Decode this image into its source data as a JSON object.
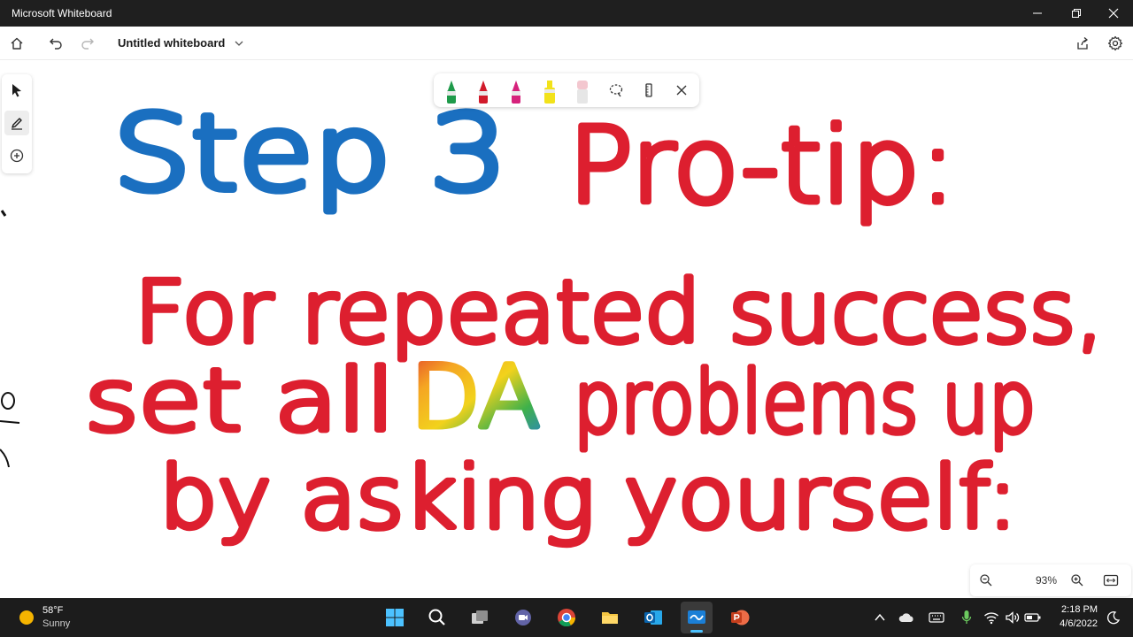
{
  "window": {
    "title": "Microsoft Whiteboard"
  },
  "toolbar": {
    "doc_title": "Untitled whiteboard"
  },
  "canvas": {
    "ink_lines": [
      {
        "text": "Step 3",
        "color": "#1a6fc0"
      },
      {
        "text": "Pro-tip:",
        "color": "#dd1f2f"
      },
      {
        "text": "For repeated success,",
        "color": "#dd1f2f"
      },
      {
        "text": "set all",
        "color": "#dd1f2f"
      },
      {
        "text": "DA",
        "color": "rainbow"
      },
      {
        "text": "problems up",
        "color": "#dd1f2f"
      },
      {
        "text": "by asking yourself:",
        "color": "#dd1f2f"
      }
    ]
  },
  "pen_tray": {
    "pens": [
      {
        "name": "green-pen",
        "color": "#1e9a4a"
      },
      {
        "name": "red-pen",
        "color": "#d11a2a"
      },
      {
        "name": "magenta-pen",
        "color": "#d6227c"
      },
      {
        "name": "yellow-highlighter",
        "color": "#f2e21a"
      },
      {
        "name": "eraser",
        "color": "#f3c7cf"
      }
    ]
  },
  "zoom": {
    "level": "93%"
  },
  "taskbar": {
    "weather": {
      "temp": "58°F",
      "desc": "Sunny"
    },
    "clock": {
      "time": "2:18 PM",
      "date": "4/6/2022"
    }
  },
  "colors": {
    "accent": "#0f6cbd",
    "ink_red": "#dd1f2f",
    "ink_blue": "#1a6fc0",
    "taskbar_bg": "#1c1c1c"
  }
}
